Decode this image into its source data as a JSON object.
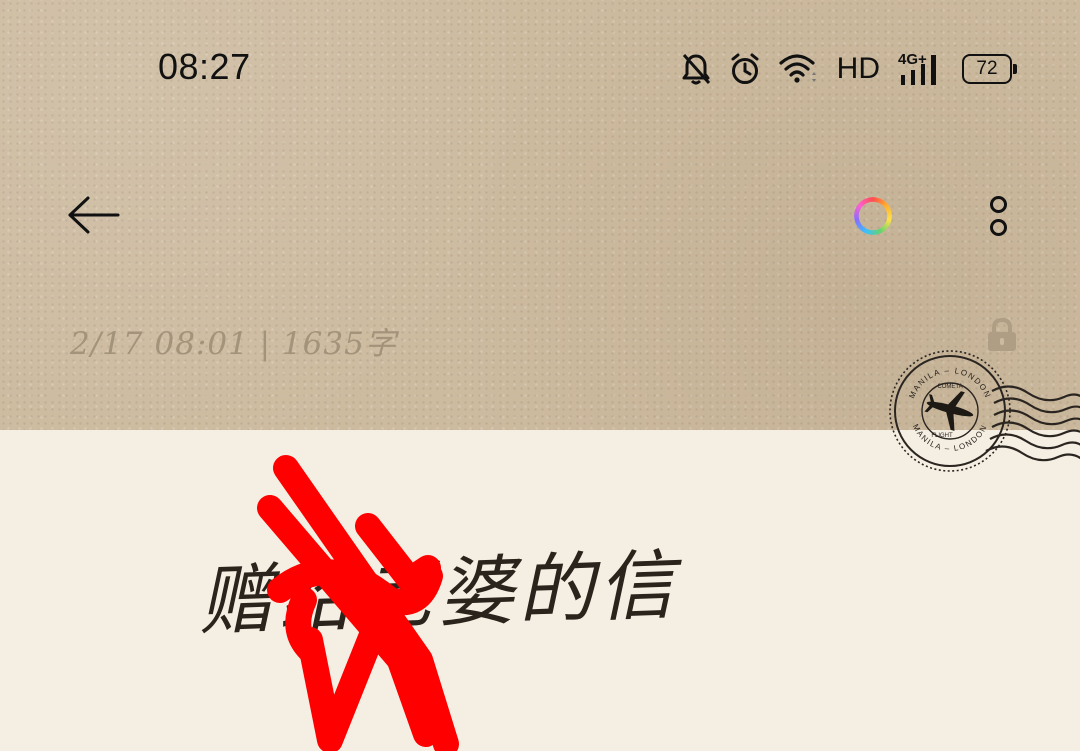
{
  "status_bar": {
    "time": "08:27",
    "icons": [
      "bell-muted-icon",
      "alarm-icon",
      "wifi-icon",
      "hd-label",
      "signal-4g-icon",
      "battery-icon"
    ],
    "hd_label": "HD",
    "network_label": "4G+",
    "battery_level": "72"
  },
  "toolbar": {
    "back_icon": "arrow-left-icon",
    "theme_icon": "color-ring-icon",
    "more_icon": "more-vertical-icon"
  },
  "note": {
    "meta": "2/17 08:01 | 1635字",
    "lock_icon": "lock-icon",
    "title": "赠给老婆的信",
    "decoration": "postmark-stamp"
  },
  "stamp": {
    "top_text": "MANILA – LONDON",
    "bottom_text": "MANILA – LONDON",
    "center_top": "COMETA",
    "center_bottom": "FLIGHT"
  },
  "colors": {
    "kraft": "#cdbba0",
    "paper": "#f5efe3",
    "ink": "#2b241c",
    "scribble": "#ff0000",
    "meta_text": "#a3937a"
  }
}
